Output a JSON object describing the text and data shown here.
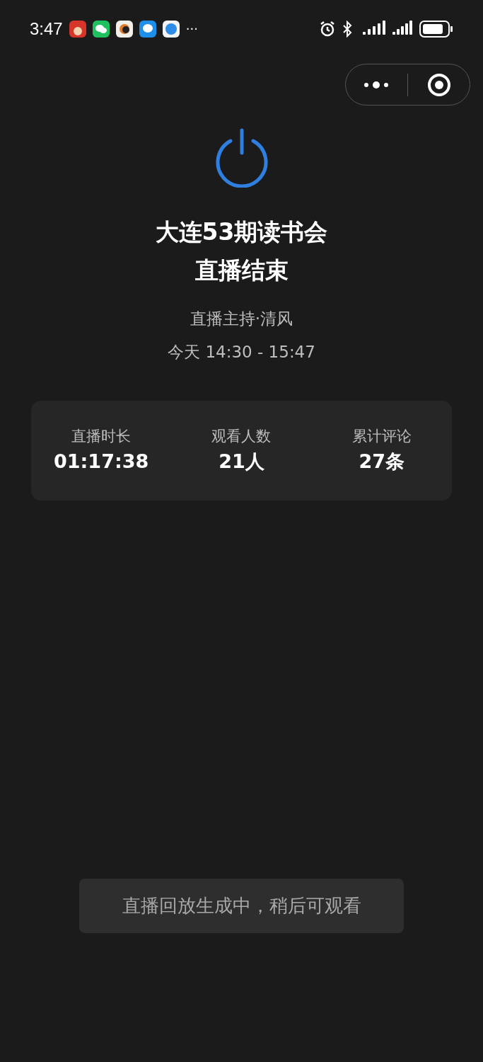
{
  "status_bar": {
    "time": "3:47",
    "more": "···"
  },
  "title": "大连53期读书会",
  "status": "直播结束",
  "host": "直播主持·清风",
  "time_range": "今天 14:30 - 15:47",
  "stats": [
    {
      "label": "直播时长",
      "value": "01:17:38"
    },
    {
      "label": "观看人数",
      "value": "21人"
    },
    {
      "label": "累计评论",
      "value": "27条"
    }
  ],
  "toast": "直播回放生成中，稍后可观看"
}
